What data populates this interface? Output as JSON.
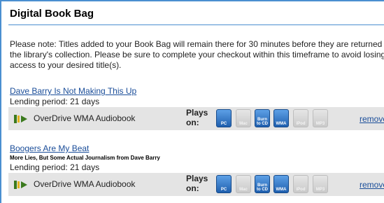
{
  "header": {
    "title": "Digital Book Bag"
  },
  "note": "Please note: Titles added to your Book Bag will remain there for 30 minutes before they are returned to the library's collection. Please be sure to complete your checkout within this timeframe to avoid losing access to your desired title(s).",
  "items": [
    {
      "title": "Dave Barry Is Not Making This Up",
      "subtitle": "",
      "lending": "Lending period: 21 days",
      "format": "OverDrive WMA Audiobook",
      "plays_on_line1": "Plays",
      "plays_on_line2": "on:",
      "remove": "remove",
      "devices": [
        {
          "label": "PC",
          "icon": "pc-icon",
          "enabled": true
        },
        {
          "label": "Mac",
          "icon": "mac-icon",
          "enabled": false
        },
        {
          "label": "Burn to CD",
          "icon": "burn-to-cd-icon",
          "enabled": true
        },
        {
          "label": "WMA",
          "icon": "wma-icon",
          "enabled": true
        },
        {
          "label": "iPod",
          "icon": "ipod-icon",
          "enabled": false
        },
        {
          "label": "MP3",
          "icon": "mp3-icon",
          "enabled": false
        }
      ]
    },
    {
      "title": "Boogers Are My Beat",
      "subtitle": "More Lies, But Some Actual Journalism from Dave Barry",
      "lending": "Lending period: 21 days",
      "format": "OverDrive WMA Audiobook",
      "plays_on_line1": "Plays",
      "plays_on_line2": "on:",
      "remove": "remove",
      "devices": [
        {
          "label": "PC",
          "icon": "pc-icon",
          "enabled": true
        },
        {
          "label": "Mac",
          "icon": "mac-icon",
          "enabled": false
        },
        {
          "label": "Burn to CD",
          "icon": "burn-to-cd-icon",
          "enabled": true
        },
        {
          "label": "WMA",
          "icon": "wma-icon",
          "enabled": true
        },
        {
          "label": "iPod",
          "icon": "ipod-icon",
          "enabled": false
        },
        {
          "label": "MP3",
          "icon": "mp3-icon",
          "enabled": false
        }
      ]
    }
  ],
  "colors": {
    "accent": "#4a8fd0",
    "link": "#1a4d99",
    "bar": "#e4e4e4"
  }
}
